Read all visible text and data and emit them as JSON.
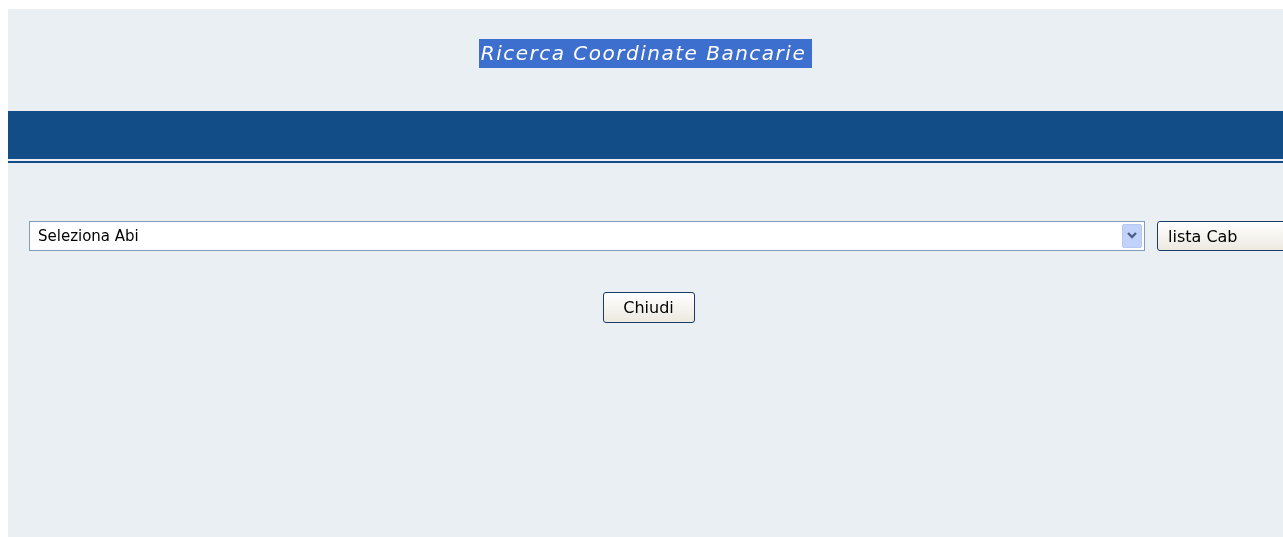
{
  "title": {
    "text": "Ricerca Coordinate Bancarie",
    "highlighted": true
  },
  "abi_select": {
    "value": "Seleziona Abi"
  },
  "buttons": [
    {
      "kind": "list",
      "label": "lista Cab"
    },
    {
      "kind": "close",
      "label": "Chiudi"
    }
  ]
}
